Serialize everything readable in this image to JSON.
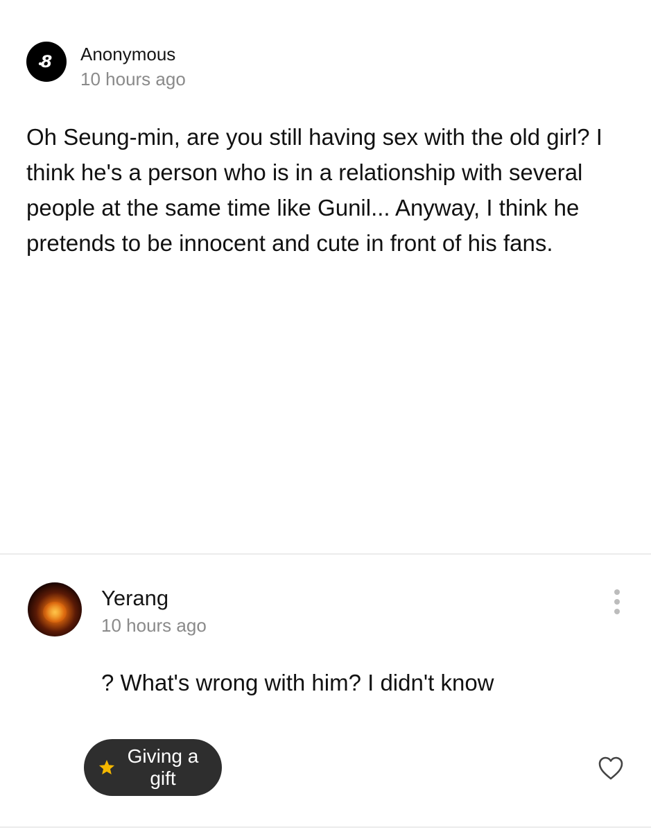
{
  "post": {
    "author": "Anonymous",
    "time": "10 hours ago",
    "body": "Oh Seung-min, are you still having sex with the old girl? I think he's a person who is in a relationship with several people at the same time like Gunil... Anyway, I think he pretends to be innocent and cute in front of his fans.",
    "avatar_icon": "anonymous-logo-icon",
    "avatar_color": "#000000"
  },
  "comment": {
    "author": "Yerang",
    "time": "10 hours ago",
    "body": "? What's wrong with him? I didn't know",
    "more_icon": "more-vertical-icon",
    "gift_label": "Giving a gift",
    "gift_icon": "star-icon",
    "gift_icon_color": "#f5b800",
    "gift_button_color": "#2e2e2e",
    "like_icon": "heart-outline-icon"
  }
}
